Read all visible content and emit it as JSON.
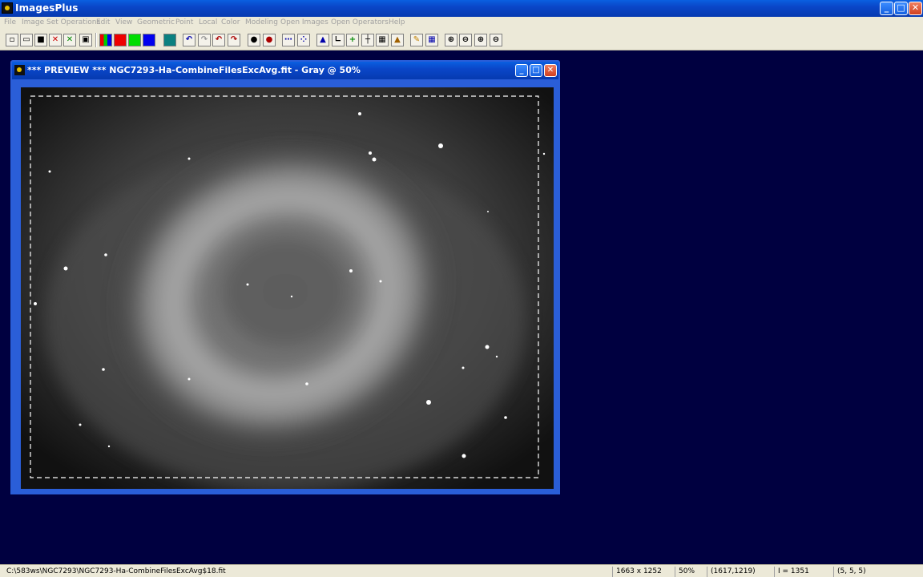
{
  "app": {
    "title": "ImagesPlus"
  },
  "menu": [
    "File",
    "Image Set Operations",
    "Edit",
    "View",
    "Geometric",
    "Point",
    "Local",
    "Color",
    "Modeling",
    "Open Images",
    "Open Operators",
    "Help"
  ],
  "toolbar": {
    "icons": [
      "new-icon",
      "open-icon",
      "save-icon",
      "close-red-x-icon",
      "close-green-x-icon",
      "print-icon",
      "rgb-channels-icon",
      "red-channel-icon",
      "green-channel-icon",
      "blue-channel-icon",
      "mosaic-icon",
      "undo-icon",
      "redo-icon",
      "undo-all-icon",
      "redo-all-icon",
      "circle-icon",
      "ellipse-icon",
      "dotted-line-icon",
      "scatter-icon",
      "histogram-icon",
      "axis-icon",
      "plus-icon",
      "crosshair-icon",
      "grid-icon",
      "photo-icon",
      "pencil-icon",
      "checker-icon",
      "zoom-in-icon",
      "zoom-out-icon",
      "zoom-fit-icon",
      "zoom-actual-icon"
    ]
  },
  "child_window": {
    "title": "*** PREVIEW *** NGC7293-Ha-CombineFilesExcAvg.fit - Gray @ 50%"
  },
  "status": {
    "path": "C:\\583ws\\NGC7293\\NGC7293-Ha-CombineFilesExcAvg$18.fit",
    "dimensions": "1663 x 1252",
    "zoom": "50%",
    "coords": "(1617,1219)",
    "intensity": "I = 1351",
    "rgb": "(5, 5, 5)"
  }
}
